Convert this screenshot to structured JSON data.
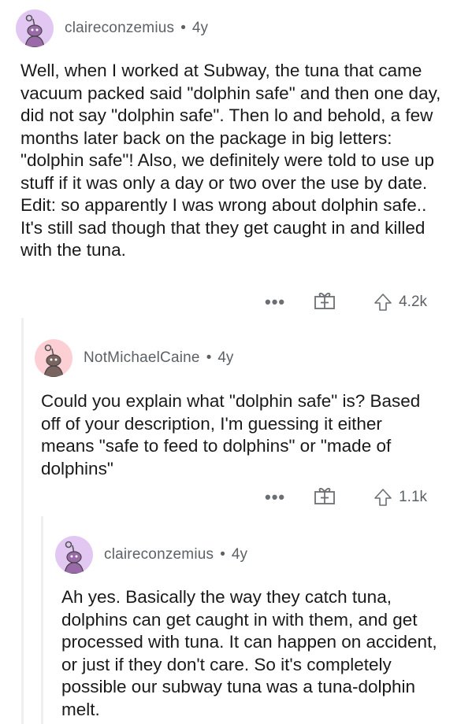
{
  "comments": [
    {
      "username": "claireconzemius",
      "age": "4y",
      "separator": "•",
      "body": "Well, when I worked at Subway, the tuna that came vacuum packed said \"dolphin safe\" and then one day, did not say \"dolphin safe\". Then lo and behold, a few months later back on the package in big letters: \"dolphin safe\"! Also, we definitely were told to use up stuff if it was only a day or two over the use by date. Edit: so apparently I was wrong about dolphin safe.. It's still sad though that they get caught in and killed with the tuna.",
      "more": "•••",
      "score": "4.2k",
      "avatar_color": "#e2c7f3"
    },
    {
      "username": "NotMichaelCaine",
      "age": "4y",
      "separator": "•",
      "body": "Could you explain what \"dolphin safe\" is? Based off of your description, I'm guessing it either means \"safe to feed to dolphins\" or \"made of dolphins\"",
      "more": "•••",
      "score": "1.1k",
      "avatar_color": "#fccfd4"
    },
    {
      "username": "claireconzemius",
      "age": "4y",
      "separator": "•",
      "body": "Ah yes. Basically the way they catch tuna, dolphins can get caught in with them, and get processed with tuna. It can happen on accident, or just if they don't care. So it's completely possible our subway tuna was a tuna-dolphin melt.",
      "avatar_color": "#e2c7f3"
    }
  ],
  "icons": {
    "award": "gift-award-icon",
    "upvote": "upvote-arrow-icon",
    "more": "more-options-icon",
    "avatar": "snoo-avatar-icon"
  }
}
